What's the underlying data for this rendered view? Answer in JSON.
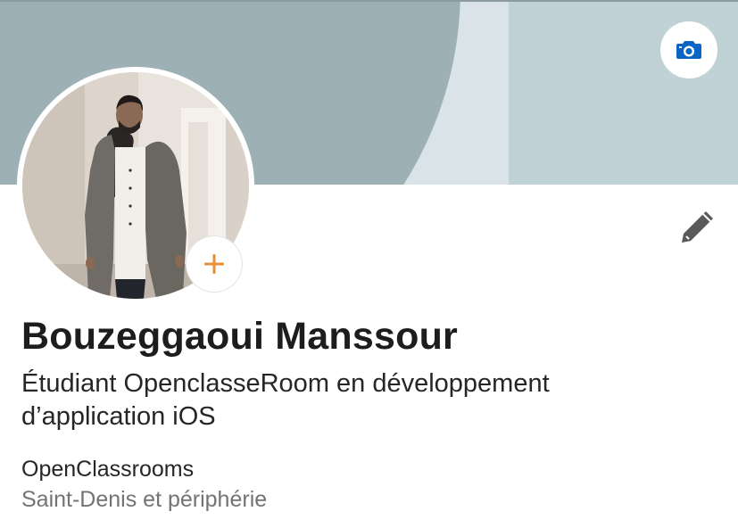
{
  "profile": {
    "name": "Bouzeggaoui Manssour",
    "headline": "Étudiant OpenclasseRoom en développement d’application iOS",
    "company": "OpenClassrooms",
    "location": "Saint-Denis et périphérie"
  },
  "icons": {
    "cover_edit": "camera-icon",
    "avatar_add": "plus-icon",
    "profile_edit": "pencil-icon"
  },
  "colors": {
    "accent_blue": "#0a66c2",
    "add_orange": "#e8913a",
    "cover_light": "#c0d2d6",
    "cover_dark": "#9db0b6"
  }
}
